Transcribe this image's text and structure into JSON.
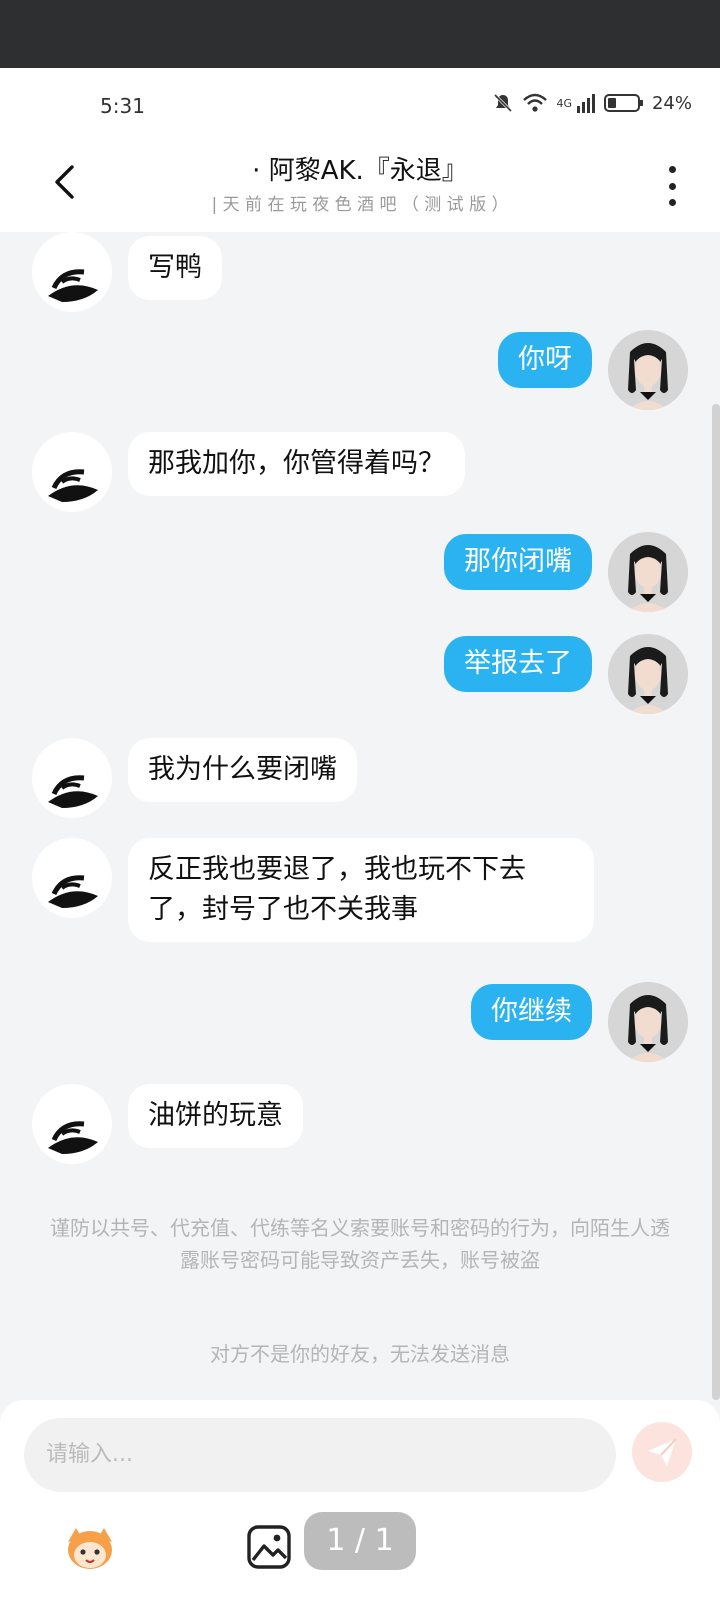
{
  "status": {
    "time": "5:31",
    "network": "4G",
    "battery": "24%"
  },
  "header": {
    "title": "· 阿黎AK.『永退』",
    "subtitle": "| 天 前 在 玩 夜 色 酒 吧 （ 测 试 版 ）"
  },
  "messages": [
    {
      "side": "left",
      "text": "写鸭"
    },
    {
      "side": "right",
      "text": "你呀"
    },
    {
      "side": "left",
      "text": "那我加你，你管得着吗？"
    },
    {
      "side": "right",
      "text": "那你闭嘴"
    },
    {
      "side": "right",
      "text": "举报去了"
    },
    {
      "side": "left",
      "text": "我为什么要闭嘴"
    },
    {
      "side": "left",
      "text": "反正我也要退了，我也玩不下去了，封号了也不关我事"
    },
    {
      "side": "right",
      "text": "你继续"
    },
    {
      "side": "left",
      "text": "油饼的玩意"
    }
  ],
  "notice": "谨防以共号、代充值、代练等名义索要账号和密码的行为，向陌生人透露账号密码可能导致资产丢失，账号被盗",
  "not_friend": "对方不是你的好友，无法发送消息",
  "input": {
    "placeholder": "请输入..."
  },
  "page_indicator": "1 / 1",
  "colors": {
    "bubble_right": "#2bb2f0",
    "send_button": "#fde3de"
  }
}
